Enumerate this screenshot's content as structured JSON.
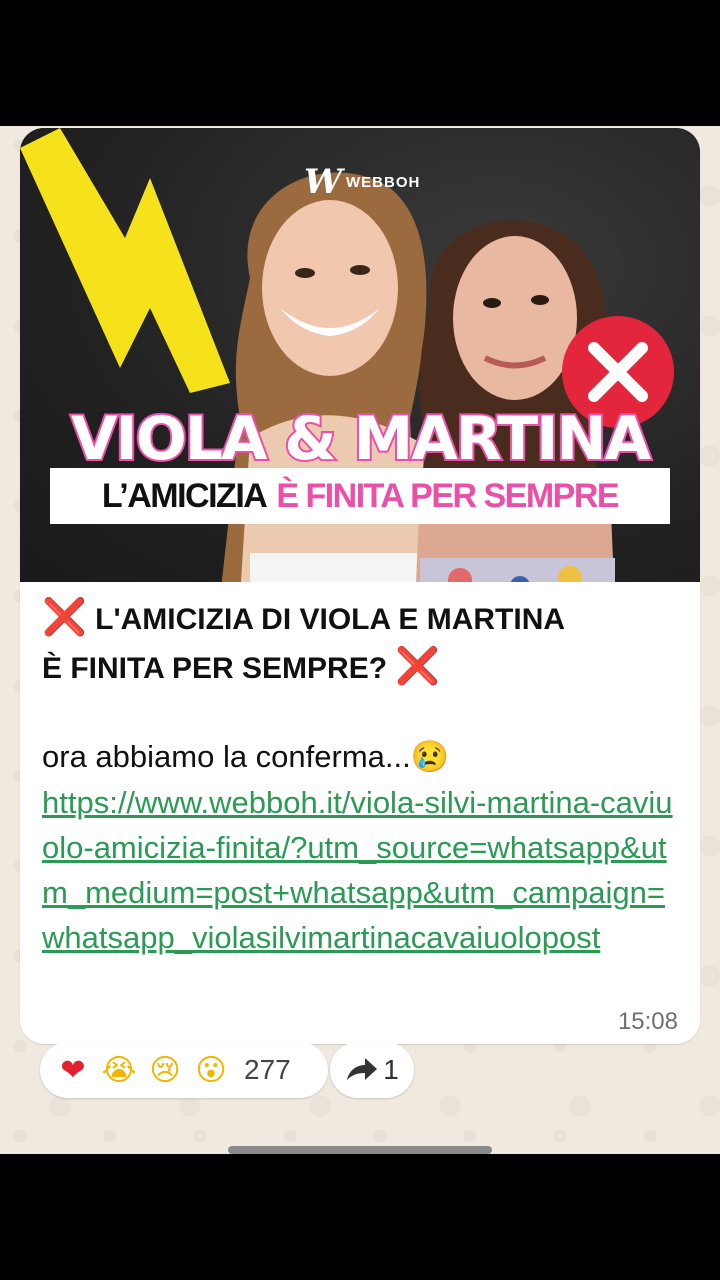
{
  "message": {
    "image": {
      "brand": "WEBBOH",
      "headline_1": "VIOLA & MARTINA",
      "headline_2_black": "L’AMICIZIA",
      "headline_2_pink": "È FINITA PER SEMPRE"
    },
    "title_line_1": "L'AMICIZIA DI VIOLA E MARTINA",
    "title_line_2": "È FINITA PER SEMPRE?",
    "cross_emoji": "❌",
    "body_text": "ora abbiamo la conferma...",
    "sad_emoji": "😢",
    "link": "https://www.webboh.it/viola-silvi-martina-caviuolo-amicizia-finita/?utm_source=whatsapp&utm_medium=post+whatsapp&utm_campaign=whatsapp_violasilvimartinacavaiuolopost",
    "time": "15:08"
  },
  "reactions": {
    "emojis": [
      "❤",
      "😭",
      "😢",
      "😮"
    ],
    "count": "277"
  },
  "forward": {
    "count": "1"
  },
  "colors": {
    "accent_pink": "#ec4fa8",
    "link_green": "#2a9a55",
    "cross_red": "#e3263b",
    "bolt_yellow": "#f5e21a"
  }
}
